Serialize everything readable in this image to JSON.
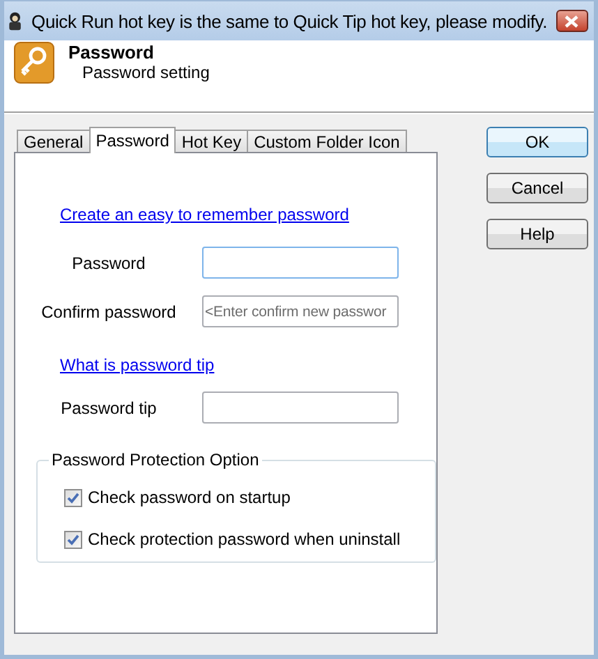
{
  "window": {
    "title": "Quick Run hot key is the same to Quick Tip hot key, please modify."
  },
  "header": {
    "title": "Password",
    "subtitle": "Password setting"
  },
  "tabs": [
    {
      "label": "General",
      "selected": false
    },
    {
      "label": "Password",
      "selected": true
    },
    {
      "label": "Hot Key",
      "selected": false
    },
    {
      "label": "Custom Folder Icon",
      "selected": false
    }
  ],
  "links": [
    {
      "label": "Create an easy to remember password"
    },
    {
      "label": "What is password tip"
    }
  ],
  "fields": [
    {
      "label": "Password",
      "focused": true
    },
    {
      "label": "Confirm password",
      "placeholder": "<Enter confirm new passwor",
      "focused": false
    },
    {
      "label": "Password tip",
      "focused": false
    }
  ],
  "group": {
    "title": "Password Protection Option",
    "options": [
      {
        "label": "Check password on startup",
        "checked": true
      },
      {
        "label": "Check protection password when uninstall",
        "checked": true
      }
    ]
  },
  "buttons": [
    {
      "label": "OK",
      "default": true
    },
    {
      "label": "Cancel",
      "default": false
    },
    {
      "label": "Help",
      "default": false
    }
  ]
}
